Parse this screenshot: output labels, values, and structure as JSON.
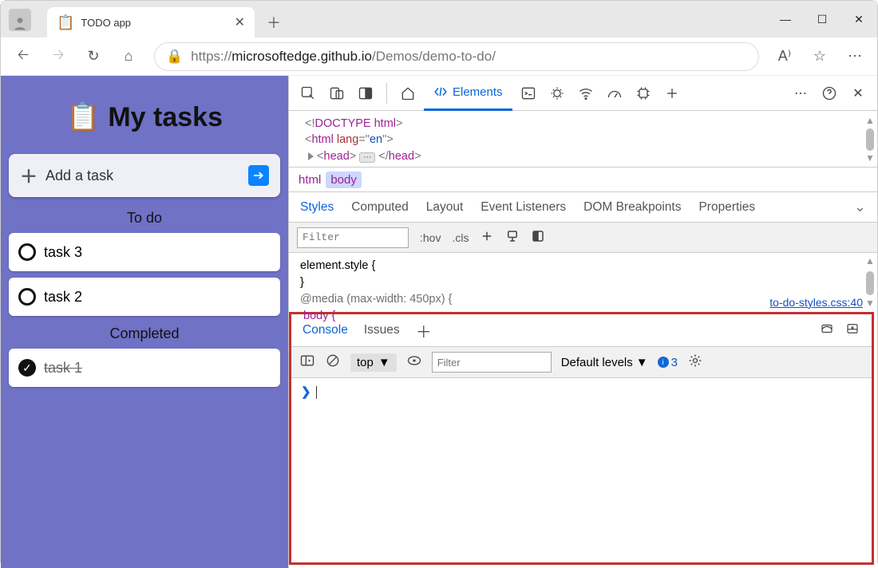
{
  "browser": {
    "tab_title": "TODO app",
    "url_prefix": "https://",
    "url_host": "microsoftedge.github.io",
    "url_path": "/Demos/demo-to-do/"
  },
  "app": {
    "title": "My tasks",
    "add_task": "Add a task",
    "todo_header": "To do",
    "completed_header": "Completed",
    "tasks_todo": [
      "task 3",
      "task 2"
    ],
    "tasks_done": [
      "task 1"
    ]
  },
  "devtools": {
    "elements_tab": "Elements",
    "dom_line1": "<!DOCTYPE html>",
    "breadcrumbs": [
      "html",
      "body"
    ],
    "style_tabs": [
      "Styles",
      "Computed",
      "Layout",
      "Event Listeners",
      "DOM Breakpoints",
      "Properties"
    ],
    "style_filter_placeholder": "Filter",
    "hov": ":hov",
    "cls": ".cls",
    "element_style": "element.style {",
    "element_style_close": "}",
    "media_rule": "@media (max-width: 450px) {",
    "body_rule": "body {",
    "css_source": "to-do-styles.css:40"
  },
  "drawer": {
    "tabs": [
      "Console",
      "Issues"
    ],
    "context": "top",
    "filter_placeholder": "Filter",
    "levels": "Default levels",
    "issue_count": "3"
  }
}
